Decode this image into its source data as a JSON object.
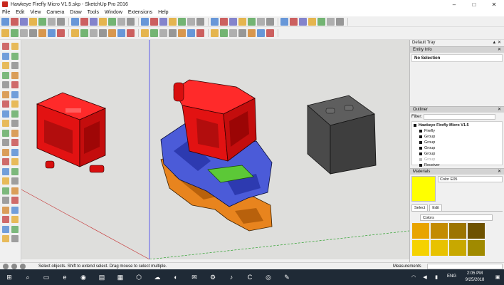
{
  "window": {
    "title": "Hawkeye Firefly Micro V1.5.skp - SketchUp Pro 2016",
    "controls": [
      "minimize-icon",
      "maximize-icon",
      "close-icon"
    ]
  },
  "menu": [
    "File",
    "Edit",
    "View",
    "Camera",
    "Draw",
    "Tools",
    "Window",
    "Extensions",
    "Help"
  ],
  "tray": {
    "title": "Default Tray",
    "entity_info": {
      "header": "Entity Info",
      "value": "No Selection"
    },
    "outliner": {
      "header": "Outliner",
      "filter_label": "Filter:",
      "items": [
        {
          "label": "Hawkeye Firefly Micro V1.5",
          "type": "root"
        },
        {
          "label": "Firefly",
          "type": "item"
        },
        {
          "label": "Group",
          "type": "item"
        },
        {
          "label": "Group",
          "type": "item"
        },
        {
          "label": "Group",
          "type": "item"
        },
        {
          "label": "Group",
          "type": "item"
        },
        {
          "label": "Group",
          "type": "dim"
        },
        {
          "label": "Receiver",
          "type": "item"
        }
      ]
    },
    "materials": {
      "header": "Materials",
      "current_name": "Color E05",
      "current_color": "#ffff00",
      "tabs": [
        "Select",
        "Edit"
      ],
      "library": "Colors",
      "swatches": [
        "#e8a400",
        "#c38b00",
        "#9c7400",
        "#6e5200",
        "#f5d200",
        "#e8c200",
        "#c8a800",
        "#a08a00"
      ]
    }
  },
  "status": {
    "hint": "Select objects. Shift to extend select. Drag mouse to select multiple.",
    "measurements_label": "Measurements"
  },
  "taskbar": {
    "language": "ENG",
    "time": "2:05 PM",
    "date": "9/25/2018"
  },
  "colors": {
    "mount_red": "#ee1111",
    "frame_blue": "#4b5bd8",
    "arm_orange": "#e8841e",
    "pad_green": "#5cc837",
    "camera_grey": "#4d4d4d"
  }
}
